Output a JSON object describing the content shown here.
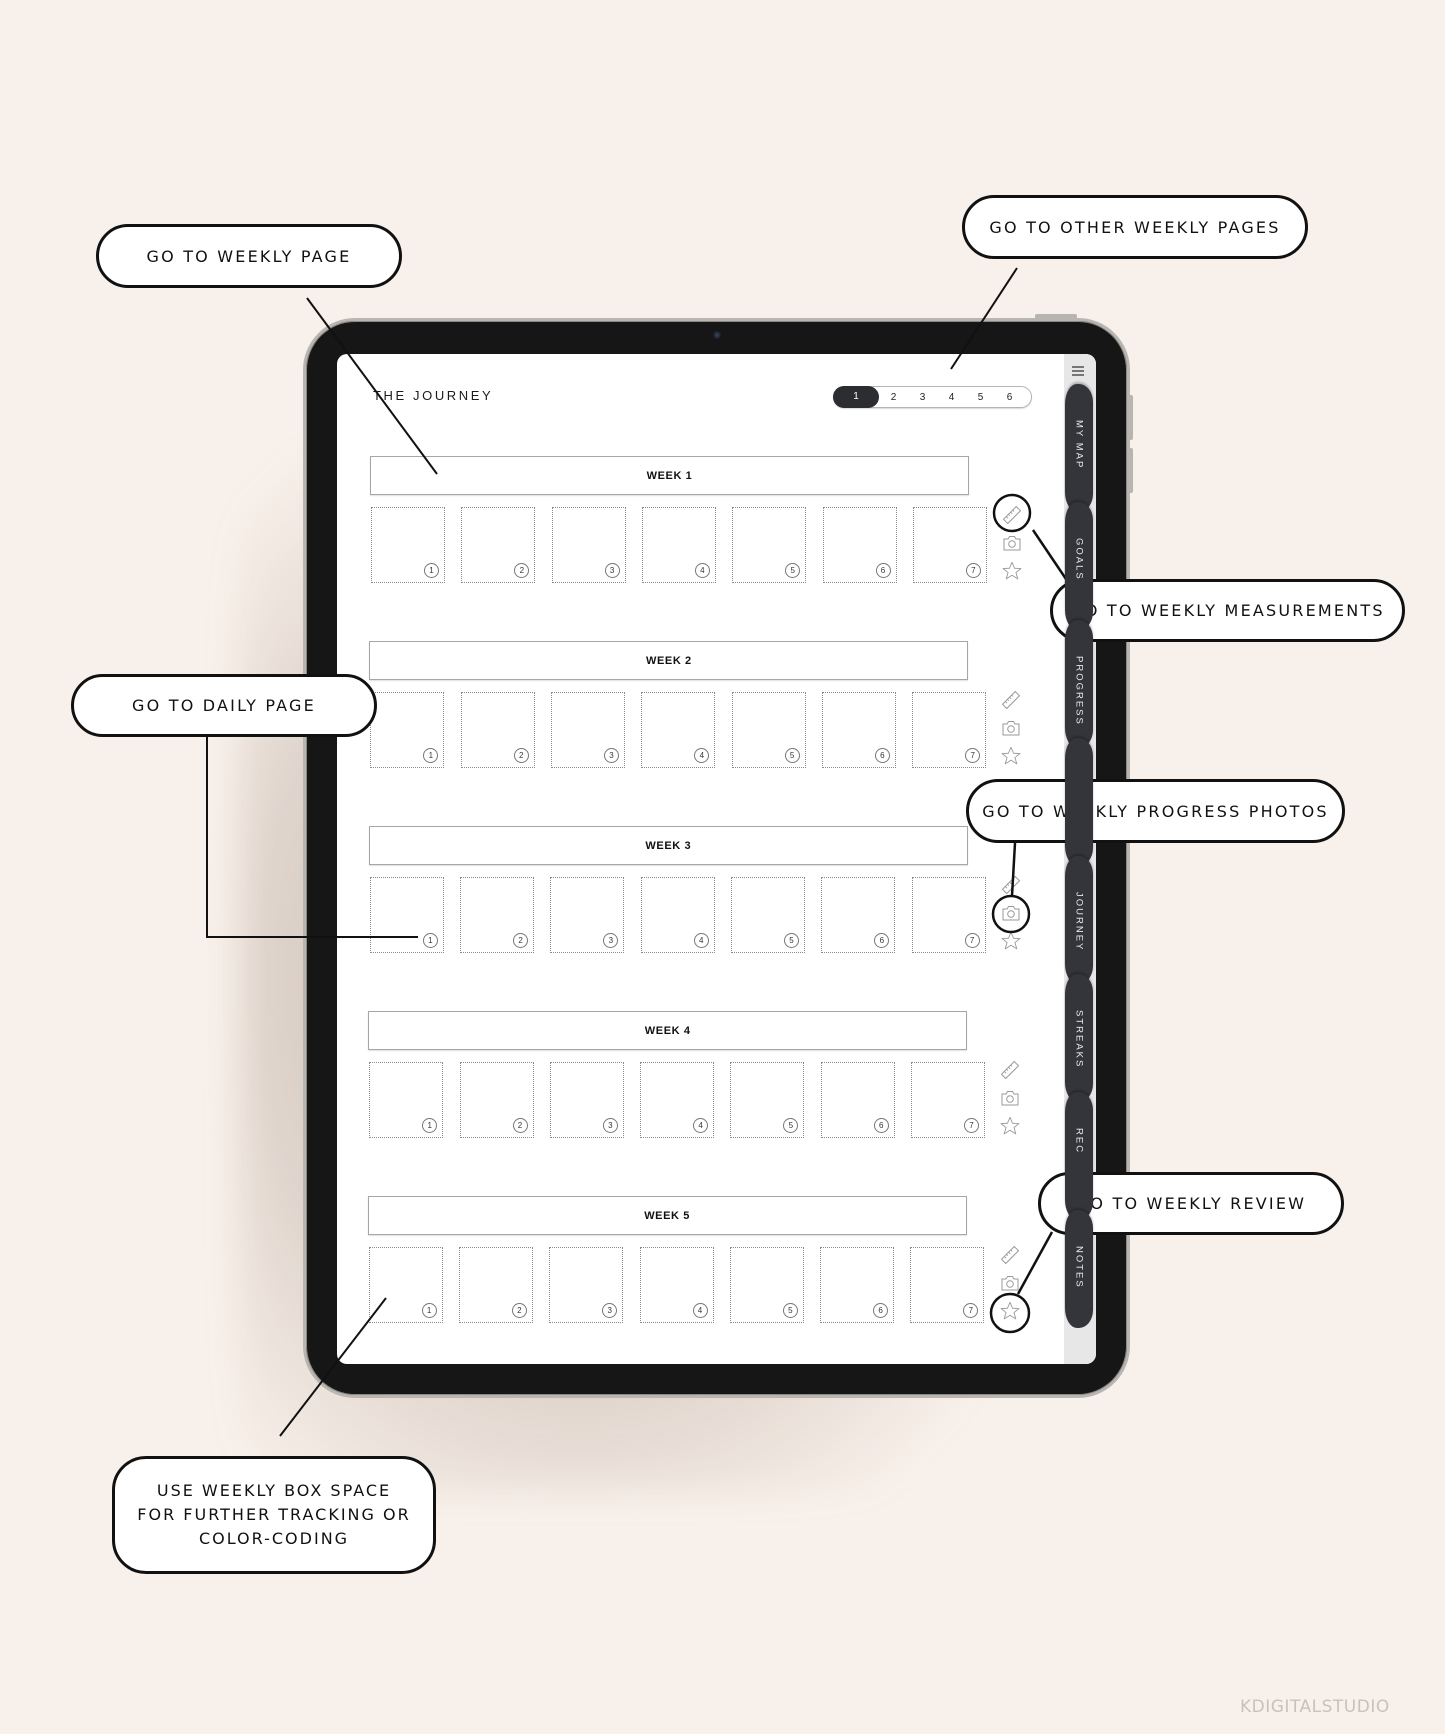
{
  "app": {
    "title": "THE JOURNEY",
    "pager": {
      "pages": [
        "1",
        "2",
        "3",
        "4",
        "5",
        "6"
      ],
      "active_index": 0
    },
    "menu_icon": "hamburger-menu-icon"
  },
  "weeks": [
    {
      "label": "WEEK 1",
      "days": [
        "1",
        "2",
        "3",
        "4",
        "5",
        "6",
        "7"
      ]
    },
    {
      "label": "WEEK 2",
      "days": [
        "1",
        "2",
        "3",
        "4",
        "5",
        "6",
        "7"
      ]
    },
    {
      "label": "WEEK 3",
      "days": [
        "1",
        "2",
        "3",
        "4",
        "5",
        "6",
        "7"
      ]
    },
    {
      "label": "WEEK 4",
      "days": [
        "1",
        "2",
        "3",
        "4",
        "5",
        "6",
        "7"
      ]
    },
    {
      "label": "WEEK 5",
      "days": [
        "1",
        "2",
        "3",
        "4",
        "5",
        "6",
        "7"
      ]
    }
  ],
  "week_icons": [
    "ruler-icon",
    "camera-icon",
    "star-icon"
  ],
  "side_tabs": [
    {
      "label": "MY MAP"
    },
    {
      "label": "GOALS"
    },
    {
      "label": "PROGRESS"
    },
    {
      "label": ""
    },
    {
      "label": "JOURNEY"
    },
    {
      "label": "STREAKS"
    },
    {
      "label": "REC"
    },
    {
      "label": "NOTES"
    }
  ],
  "callouts": {
    "weekly_page": "GO TO WEEKLY PAGE",
    "other_weekly_pages": "GO TO OTHER WEEKLY PAGES",
    "weekly_measurements": "GO TO WEEKLY MEASUREMENTS",
    "daily_page": "GO TO DAILY PAGE",
    "weekly_progress_photos": "GO TO WEEKLY PROGRESS PHOTOS",
    "weekly_review": "GO TO WEEKLY REVIEW",
    "box_space": [
      "USE WEEKLY BOX SPACE",
      "FOR FURTHER TRACKING OR",
      "COLOR-CODING"
    ]
  },
  "watermark": "KDIGITALSTUDIO",
  "colors": {
    "background": "#f8f0ea",
    "bezel": "#161616",
    "tab": "#34353a",
    "pager_active": "#2c2d31"
  }
}
